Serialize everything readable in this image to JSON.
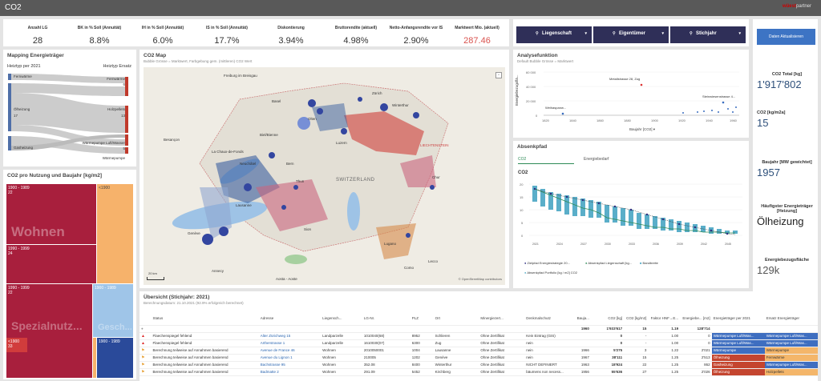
{
  "app": {
    "title": "CO2",
    "brand_prefix": "wüest",
    "brand_suffix": "partner"
  },
  "kpis": [
    {
      "label": "Anzahl LG",
      "value": "28"
    },
    {
      "label": "BK in % Soll (Annuität)",
      "value": "8.8%"
    },
    {
      "label": "IH in % Soll (Annuität)",
      "value": "6.0%"
    },
    {
      "label": "IS in % Soll (Annuität)",
      "value": "17.7%"
    },
    {
      "label": "Diskontierung",
      "value": "3.94%"
    },
    {
      "label": "Bruttorendite (aktuell)",
      "value": "4.98%"
    },
    {
      "label": "Netto-Anfangsrendite vor IS",
      "value": "2.90%"
    },
    {
      "label": "Marktwert Mio. (aktuell)",
      "value": "287.46"
    }
  ],
  "filters": [
    {
      "label": "Liegenschaft"
    },
    {
      "label": "Eigentümer"
    },
    {
      "label": "Stichjahr"
    }
  ],
  "refresh_button": "Daten Aktualisieren",
  "mapping": {
    "title": "Mapping Energieträger",
    "left_header": "Heiztyp per 2021",
    "right_header": "Heiztyp Ersatz",
    "left": [
      {
        "name": "Fernwärme",
        "count": ""
      },
      {
        "name": "Ölheizung",
        "count": "17"
      },
      {
        "name": "Gasheizung",
        "count": ""
      }
    ],
    "right": [
      {
        "name": "Fernwärme",
        "count": "6"
      },
      {
        "name": "Holzpellets",
        "count": "13"
      },
      {
        "name": "Wärmepumpe Luft/Wasser",
        "count": "5"
      },
      {
        "name": "Wärmepumpe",
        "count": ""
      }
    ]
  },
  "treemap": {
    "title": "CO2 pro Nutzung und Baujahr [kg/m2]",
    "cells": [
      {
        "label": "1900 - 1989",
        "sub": "22"
      },
      {
        "label": "1900 - 1989",
        "sub": ""
      },
      {
        "label": "<1900",
        "sub": ""
      },
      {
        "label": "1990 - 1999",
        "sub": "24"
      },
      {
        "label": "1990 - 1999",
        "sub": ""
      },
      {
        "label": "1900 - 1989",
        "sub": ""
      },
      {
        "label": "<1900",
        "sub": "33"
      },
      {
        "label": "1900 - 1989",
        "sub": ""
      }
    ],
    "big_labels": [
      "Wohnen",
      "Spezialnutz...",
      "Gesch..."
    ]
  },
  "map": {
    "title": "CO2 Map",
    "subtitle": "Bubble Grösse = Marktwert, Farbgebung gem. (mittleren) CO2 Wert",
    "labels": [
      "Basel",
      "Zürich",
      "Besançon",
      "La Chaux-de-Fonds",
      "Neuchâtel",
      "Bern",
      "SWITZERLAND",
      "Luzern",
      "Lausanne",
      "Genève",
      "Annecy",
      "Sion",
      "Lugano",
      "Como",
      "Lecco",
      "Aosta - Aoste",
      "Freiburg im Breisgau",
      "LIECHTENSTEIN",
      "Thun",
      "Chur",
      "Olten",
      "Biel/Bienne",
      "Winterthur"
    ],
    "scale": "20 km",
    "attribution": "© OpenStreetMap contributors"
  },
  "analyse": {
    "title": "Analysefunktion",
    "subtitle": "Default Bubble Grösse = Marktwert",
    "ylabel": "Energiebezugsflä...",
    "xlabel": "Baujahr [CO2]",
    "annotations": [
      "Metallstrasse 28, Zug",
      "Weihaspanw...",
      "Steinwiesenstrasse 4..."
    ]
  },
  "absenkpfad": {
    "title": "Absenkpfad",
    "tabs": [
      "CO2",
      "Energiebedarf"
    ],
    "chart_title": "CO2",
    "legend": [
      "Zielpfad Energiestrategie 20...",
      "Absenkpfad Liegenschaft [kg...",
      "Bandbreite",
      "Absenkpfad Portfolio [kg / m2] CO2"
    ]
  },
  "right_kpis": [
    {
      "label": "CO2 Total [kg]",
      "value": "1'917'802"
    },
    {
      "label": "CO2 [kg/m2a]",
      "value": "15"
    },
    {
      "label": "Baujahr [MW gewichtet]",
      "value": "1957"
    },
    {
      "label": "Häufigster Energieträger [Heizung]",
      "value": "Ölheizung"
    },
    {
      "label": "Energiebezugsfläche",
      "value": "129k"
    }
  ],
  "table": {
    "title": "Übersicht (Stichjahr: 2021)",
    "subtitle": "Berechnungsdatum: 21.10.2021 (92.9% erfolgreich berechnet)",
    "headers": [
      "Status",
      "Adresse",
      "Liegensch...",
      "LG-Nr.",
      "PLZ",
      "Ort",
      "Minergiezert...",
      "Denkmalschutz",
      "Bauja...",
      "CO2 [kg]",
      "CO2 [kg/m2]",
      "Faktor HNF→E...",
      "Energiebe... [m2]",
      "Energieträger per 2021",
      "Ersatz Energieträger"
    ],
    "totals": [
      "",
      "",
      "",
      "",
      "",
      "",
      "",
      "",
      "1960",
      "1'933'617",
      "15",
      "1.19",
      "128'714",
      "",
      ""
    ],
    "rows": [
      [
        "Flaechenspiegel fehlend",
        "Alter Zürichweg 15",
        "Landparzelle",
        "1010040(68)",
        "8952",
        "Schlieren",
        "Ohne Zertifikat",
        "Kein Eintrag (GIS)",
        "",
        "0",
        "-",
        "1.00",
        "0",
        "Wärmepumpe Luft/Was...",
        "Wärmepumpe Luft/Was..."
      ],
      [
        "Flaechenspiegel fehlend",
        "Artherstrasse 1",
        "Landparzelle",
        "1610030(07)",
        "6300",
        "Zug",
        "Ohne Zertifikat",
        "nein",
        "",
        "0",
        "-",
        "1.00",
        "0",
        "Wärmepumpe Luft/Was...",
        "Wärmepumpe Luft/Was..."
      ],
      [
        "Berechnung teilweise auf Annahmen basierend",
        "Avenue de France 46",
        "Wohnen",
        "2010050001",
        "1004",
        "Lausanne",
        "Ohne Zertifikat",
        "nein",
        "1966",
        "5'275",
        "3",
        "1.22",
        "2'021",
        "Wärmepumpe",
        "Wärmepumpe"
      ],
      [
        "Berechnung teilweise auf Annahmen basierend",
        "Avenue du Lignon 1",
        "Wohnen",
        "210005",
        "1202",
        "Genève",
        "Ohne Zertifikat",
        "nein",
        "1967",
        "38'111",
        "15",
        "1.25",
        "2'513",
        "Ölheizung",
        "Fernwärme"
      ],
      [
        "Berechnung teilweise auf Annahmen basierend",
        "Bachstrasse 95",
        "Wohnen",
        "352.08",
        "8400",
        "Winterthur",
        "Ohne Zertifikat",
        "NICHT DEFINIERT",
        "1963",
        "18'924",
        "22",
        "1.25",
        "862",
        "Gasheizung",
        "Wärmepumpe Luft/Was..."
      ],
      [
        "Berechnung teilweise auf Annahmen basierend",
        "Badmatte 2",
        "Wohnen",
        "291.09",
        "5452",
        "Kirchberg",
        "Ohne Zertifikat",
        "bäumens non necess...",
        "1956",
        "55'636",
        "27",
        "1.25",
        "2'026",
        "Ölheizung",
        "Holzpellets"
      ]
    ]
  }
}
